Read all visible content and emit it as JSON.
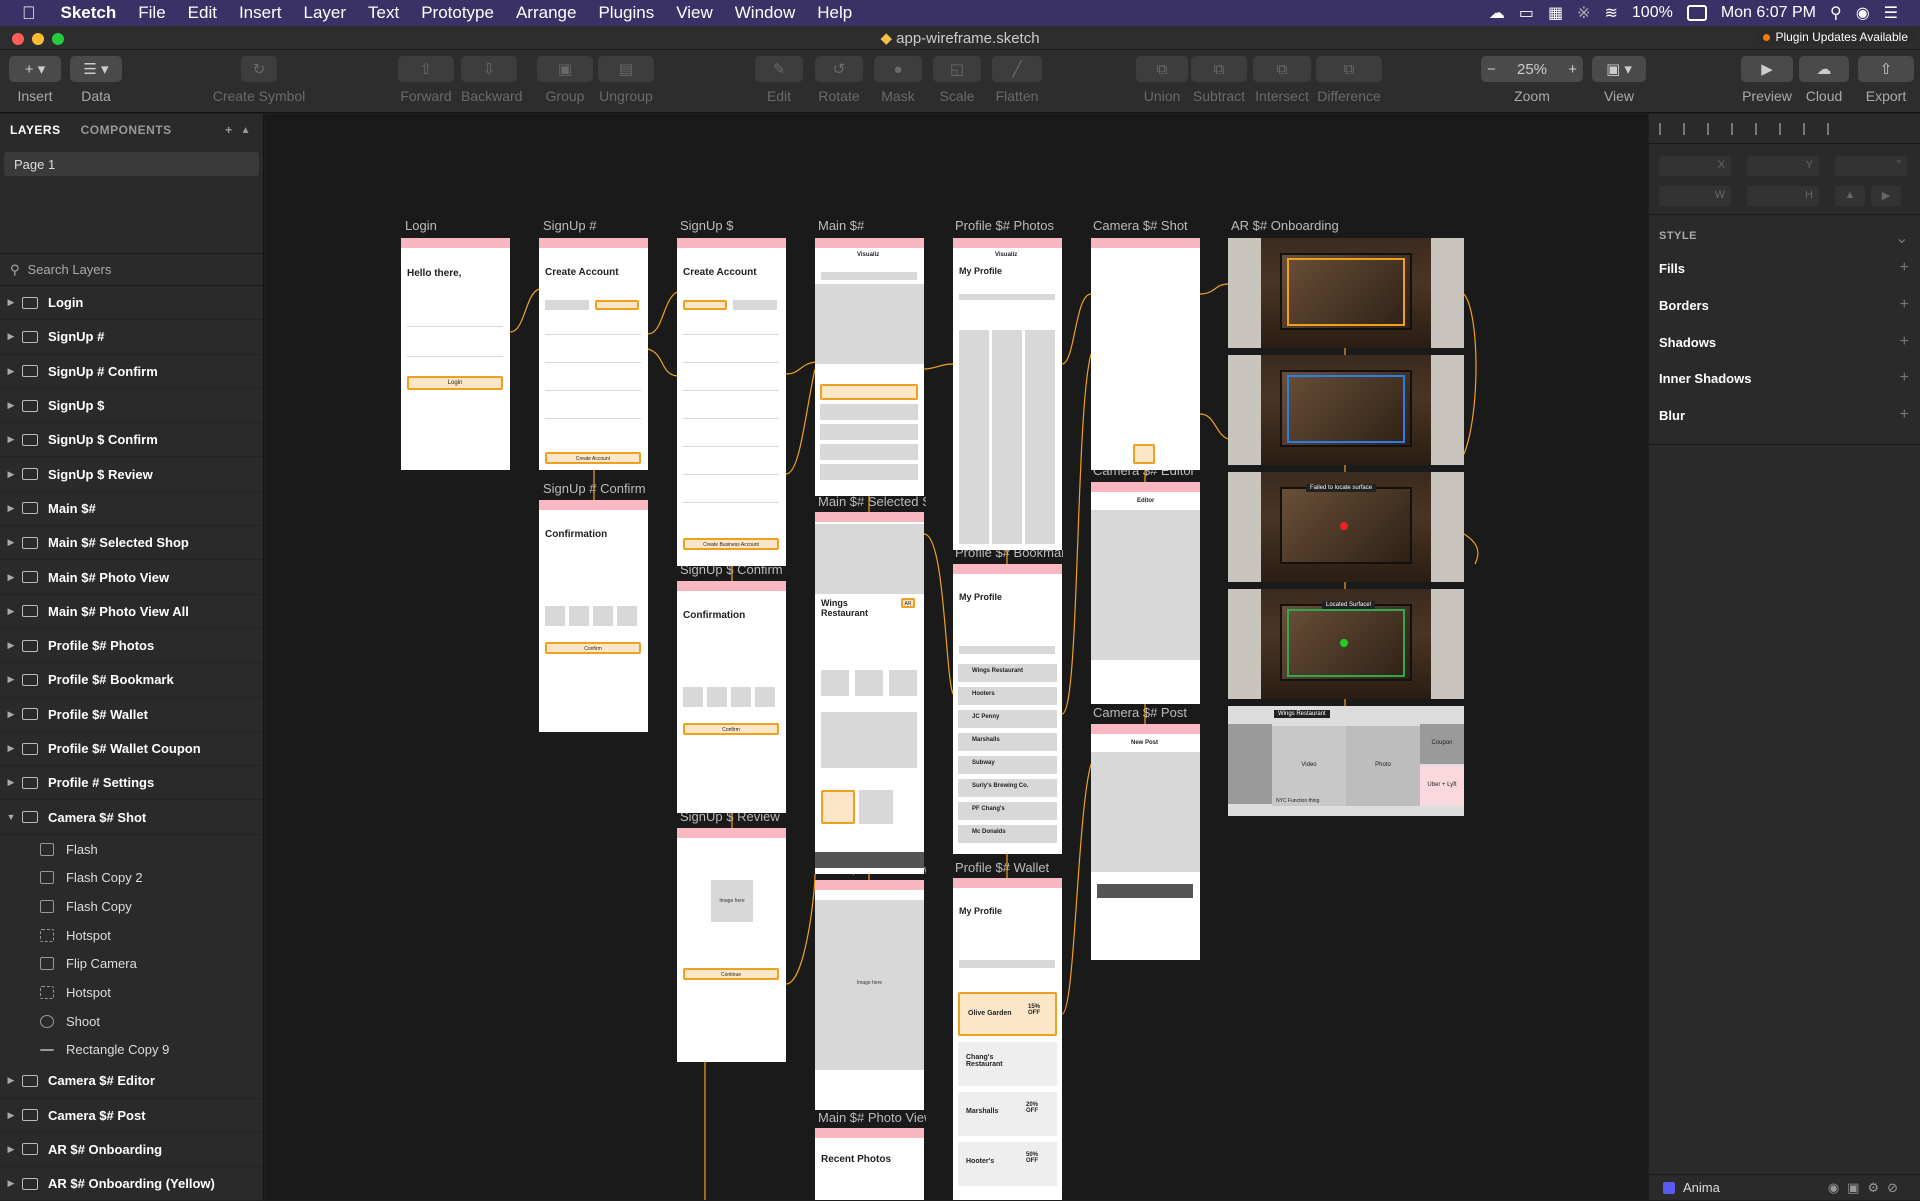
{
  "menubar": {
    "app_name": "Sketch",
    "items": [
      "File",
      "Edit",
      "Insert",
      "Layer",
      "Text",
      "Prototype",
      "Arrange",
      "Plugins",
      "View",
      "Window",
      "Help"
    ],
    "battery": "100%",
    "clock": "Mon 6:07 PM"
  },
  "titlebar": {
    "doc_title": "app-wireframe.sketch",
    "plugin_badge": "Plugin Updates Available"
  },
  "toolbar": {
    "insert": "Insert",
    "data": "Data",
    "create_symbol": "Create Symbol",
    "forward": "Forward",
    "backward": "Backward",
    "group": "Group",
    "ungroup": "Ungroup",
    "edit": "Edit",
    "rotate": "Rotate",
    "mask": "Mask",
    "scale": "Scale",
    "flatten": "Flatten",
    "union": "Union",
    "subtract": "Subtract",
    "intersect": "Intersect",
    "difference": "Difference",
    "zoom_label": "Zoom",
    "zoom_value": "25%",
    "view": "View",
    "preview": "Preview",
    "cloud": "Cloud",
    "export": "Export"
  },
  "left_panel": {
    "tab_layers": "LAYERS",
    "tab_components": "COMPONENTS",
    "page": "Page 1",
    "search_placeholder": "Search Layers",
    "layers": [
      "Login",
      "SignUp #",
      "SignUp # Confirm",
      "SignUp $",
      "SignUp $ Confirm",
      "SignUp $ Review",
      "Main $#",
      "Main $# Selected Shop",
      "Main $# Photo View",
      "Main $# Photo View All",
      "Profile $# Photos",
      "Profile $# Bookmark",
      "Profile $# Wallet",
      "Profile $# Wallet Coupon",
      "Profile # Settings",
      "Camera $# Shot"
    ],
    "children": [
      "Flash",
      "Flash Copy 2",
      "Flash Copy",
      "Hotspot",
      "Flip Camera",
      "Hotspot",
      "Shoot",
      "Rectangle Copy 9"
    ],
    "layers_after": [
      "Camera $# Editor",
      "Camera $# Post",
      "AR $# Onboarding",
      "AR $# Onboarding (Yellow)"
    ]
  },
  "canvas": {
    "artboard_labels": {
      "login": "Login",
      "signup_hash": "SignUp #",
      "signup_dollar": "SignUp $",
      "main": "Main $#",
      "profile_photos": "Profile $# Photos",
      "camera_shot": "Camera $# Shot",
      "ar_onboarding": "AR $# Onboarding",
      "signup_confirm": "SignUp # Confirm",
      "main_selected": "Main $# Selected Shop",
      "profile_bookmark": "Profile $# Bookmark",
      "camera_editor": "Camera $# Editor",
      "signup_dollar_confirm": "SignUp $ Confirm",
      "camera_post": "Camera $# Post",
      "signup_review": "SignUp $ Review",
      "main_photo_view": "Main $# Photo View",
      "profile_wallet": "Profile $# Wallet",
      "main_view_all": "Main $# Photo View All"
    },
    "login": {
      "title": "Hello there,",
      "button": "Login"
    },
    "signup": {
      "title": "Create Account",
      "button": "Create Account"
    },
    "signup_b": {
      "title": "Create Account",
      "button": "Create Business Account"
    },
    "confirm": {
      "title": "Confirmation",
      "button": "Confirm"
    },
    "main": {
      "header": "Visualiz"
    },
    "selected": {
      "title": "Wings Restaurant",
      "badge": "AR"
    },
    "profile": {
      "title": "My Profile",
      "header": "Visualiz"
    },
    "bookmark_list": [
      "Wings Restaurant",
      "Hooters",
      "JC Penny",
      "Marshalls",
      "Subway",
      "Surly's Brewing Co.",
      "PF Chang's",
      "Mc Donalds"
    ],
    "wallet": {
      "coupon1": "Olive Garden",
      "coupon1_off": "15% OFF",
      "coupon2": "Chang's Restaurant",
      "coupon3": "Marshalls",
      "coupon3_off": "20% OFF",
      "coupon4": "Hooter's",
      "coupon4_off": "50% OFF"
    },
    "editor": {
      "title": "Editor"
    },
    "post": {
      "title": "New Post"
    },
    "review": {
      "image": "Image here",
      "button": "Continue"
    },
    "photo_view": {
      "image": "Image here"
    },
    "view_all": {
      "title": "Recent Photos"
    },
    "ar": {
      "msg1": "Failed to locate surface",
      "msg2": "Located Surface!",
      "tag": "Wings Restaurant",
      "video": "Video",
      "photo": "Photo",
      "coupon": "Coupon",
      "uber": "Uber + Lyft",
      "nyc": "NYC Function thing"
    }
  },
  "right_panel": {
    "x": "X",
    "y": "Y",
    "w": "W",
    "h": "H",
    "style": "STYLE",
    "fills": "Fills",
    "borders": "Borders",
    "shadows": "Shadows",
    "inner_shadows": "Inner Shadows",
    "blur": "Blur",
    "anima": "Anima"
  }
}
